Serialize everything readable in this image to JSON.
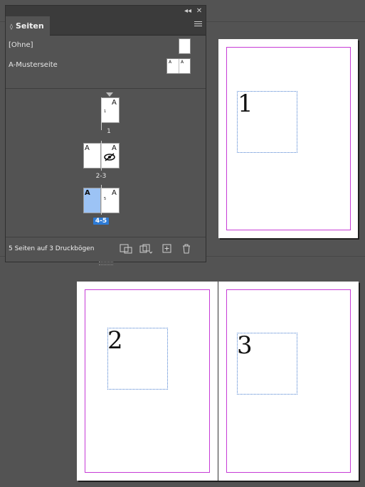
{
  "panel": {
    "tab_label": "Seiten",
    "masters": [
      {
        "label": "[Ohne]"
      },
      {
        "label": "A-Musterseite",
        "left_prefix": "A",
        "right_prefix": "A"
      }
    ],
    "pages": [
      {
        "label": "1",
        "prefix": "A",
        "number": "1"
      },
      {
        "label": "2-3",
        "left_prefix": "A",
        "right_prefix": "A"
      },
      {
        "label": "4-5",
        "left_prefix": "A",
        "right_prefix": "A",
        "right_number": "5",
        "selected": true
      }
    ],
    "status": "5 Seiten auf 3 Druckbögen",
    "footer_icons": [
      "page-size-icon",
      "new-master-page-icon",
      "new-page-icon",
      "delete-page-icon"
    ]
  },
  "document": {
    "pages": [
      {
        "number": "1"
      },
      {
        "number": "2"
      },
      {
        "number": "3"
      }
    ]
  },
  "colors": {
    "margin_guide": "#c63bd6",
    "frame_edge": "#4a7fd0",
    "selection": "#2d7bd6",
    "selected_page": "#9cc3f5"
  }
}
